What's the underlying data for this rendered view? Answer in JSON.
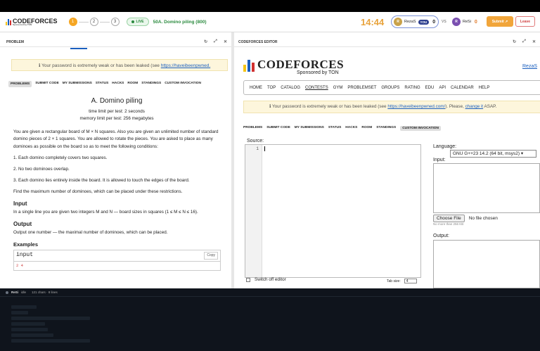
{
  "header": {
    "logo_text": "CODEFORCES",
    "logo_sub": "Sponsored by TON",
    "steps": [
      "1",
      "2",
      "3"
    ],
    "live_label": "LIVE",
    "problem_title": "50A. Domino piling (800)",
    "timer": "14:44",
    "player1": {
      "initial": "R",
      "name": "RezaS",
      "tag": "YOU",
      "score": "0"
    },
    "vs": "VS",
    "player2": {
      "initial": "R",
      "name": "ReSi",
      "score": "0"
    },
    "submit_label": "Submit",
    "leave_label": "Leave",
    "colors": {
      "accent": "#f1a53a",
      "live": "#2a8a3e",
      "timer": "#e8a33c"
    }
  },
  "problem_panel": {
    "title": "PROBLEM",
    "icons": [
      "refresh-icon",
      "expand-icon",
      "close-icon"
    ],
    "warning_prefix": "ℹ Your password is extremely weak or has been leaked (see ",
    "warning_link": "https://haveibeenpwned.",
    "nav": [
      "PROBLEMS",
      "SUBMIT CODE",
      "MY SUBMISSIONS",
      "STATUS",
      "HACKS",
      "ROOM",
      "STANDINGS",
      "CUSTOM INVOCATION"
    ],
    "problem_name": "A. Domino piling",
    "time_limit": "time limit per test: 2 seconds",
    "memory_limit": "memory limit per test: 256 megabytes",
    "statement": [
      "You are given a rectangular board of M × N squares. Also you are given an unlimited number of standard domino pieces of 2 × 1 squares. You are allowed to rotate the pieces. You are asked to place as many dominoes as possible on the board so as to meet the following conditions:",
      "1. Each domino completely covers two squares.",
      "2. No two dominoes overlap.",
      "3. Each domino lies entirely inside the board. It is allowed to touch the edges of the board.",
      "Find the maximum number of dominoes, which can be placed under these restrictions."
    ],
    "input_heading": "Input",
    "input_text": "In a single line you are given two integers M and N — board sizes in squares (1 ≤ M ≤ N ≤ 16).",
    "output_heading": "Output",
    "output_text": "Output one number — the maximal number of dominoes, which can be placed.",
    "examples_heading": "Examples",
    "example_input_label": "input",
    "copy_label": "Copy",
    "example_input_value": "2 4"
  },
  "editor_panel": {
    "title": "CODEFORCES EDITOR",
    "icons": [
      "refresh-icon",
      "expand-icon",
      "close-icon"
    ],
    "logo_text": "CODEFORCES",
    "logo_sub": "Sponsored by TON",
    "user_link": "RezaS",
    "menu": [
      "HOME",
      "TOP",
      "CATALOG",
      "CONTESTS",
      "GYM",
      "PROBLEMSET",
      "GROUPS",
      "RATING",
      "EDU",
      "API",
      "CALENDAR",
      "HELP"
    ],
    "warning_prefix": "ℹ Your password is extremely weak or has been leaked (see ",
    "warning_link": "https://haveibeenpwned.com/",
    "warning_mid": "). Please, ",
    "warning_link2": "change it",
    "warning_suffix": " ASAP.",
    "nav": [
      "PROBLEMS",
      "SUBMIT CODE",
      "MY SUBMISSIONS",
      "STATUS",
      "HACKS",
      "ROOM",
      "STANDINGS",
      "CUSTOM INVOCATION"
    ],
    "source_label": "Source:",
    "line_number": "1",
    "switch_label": "Switch off editor",
    "tab_size_label": "Tab size:",
    "tab_size_value": "4",
    "language_label": "Language:",
    "language_value": "GNU G++23 14.2 (64 bit, msys2)",
    "input_label": "Input:",
    "choose_file": "Choose File",
    "no_file": "No file chosen",
    "no_more": "No more than 256 KB",
    "output_label": "Output:"
  },
  "terminal": {
    "user": "ReSi",
    "status": "idle",
    "meta": "121 chars · 8 lines"
  }
}
